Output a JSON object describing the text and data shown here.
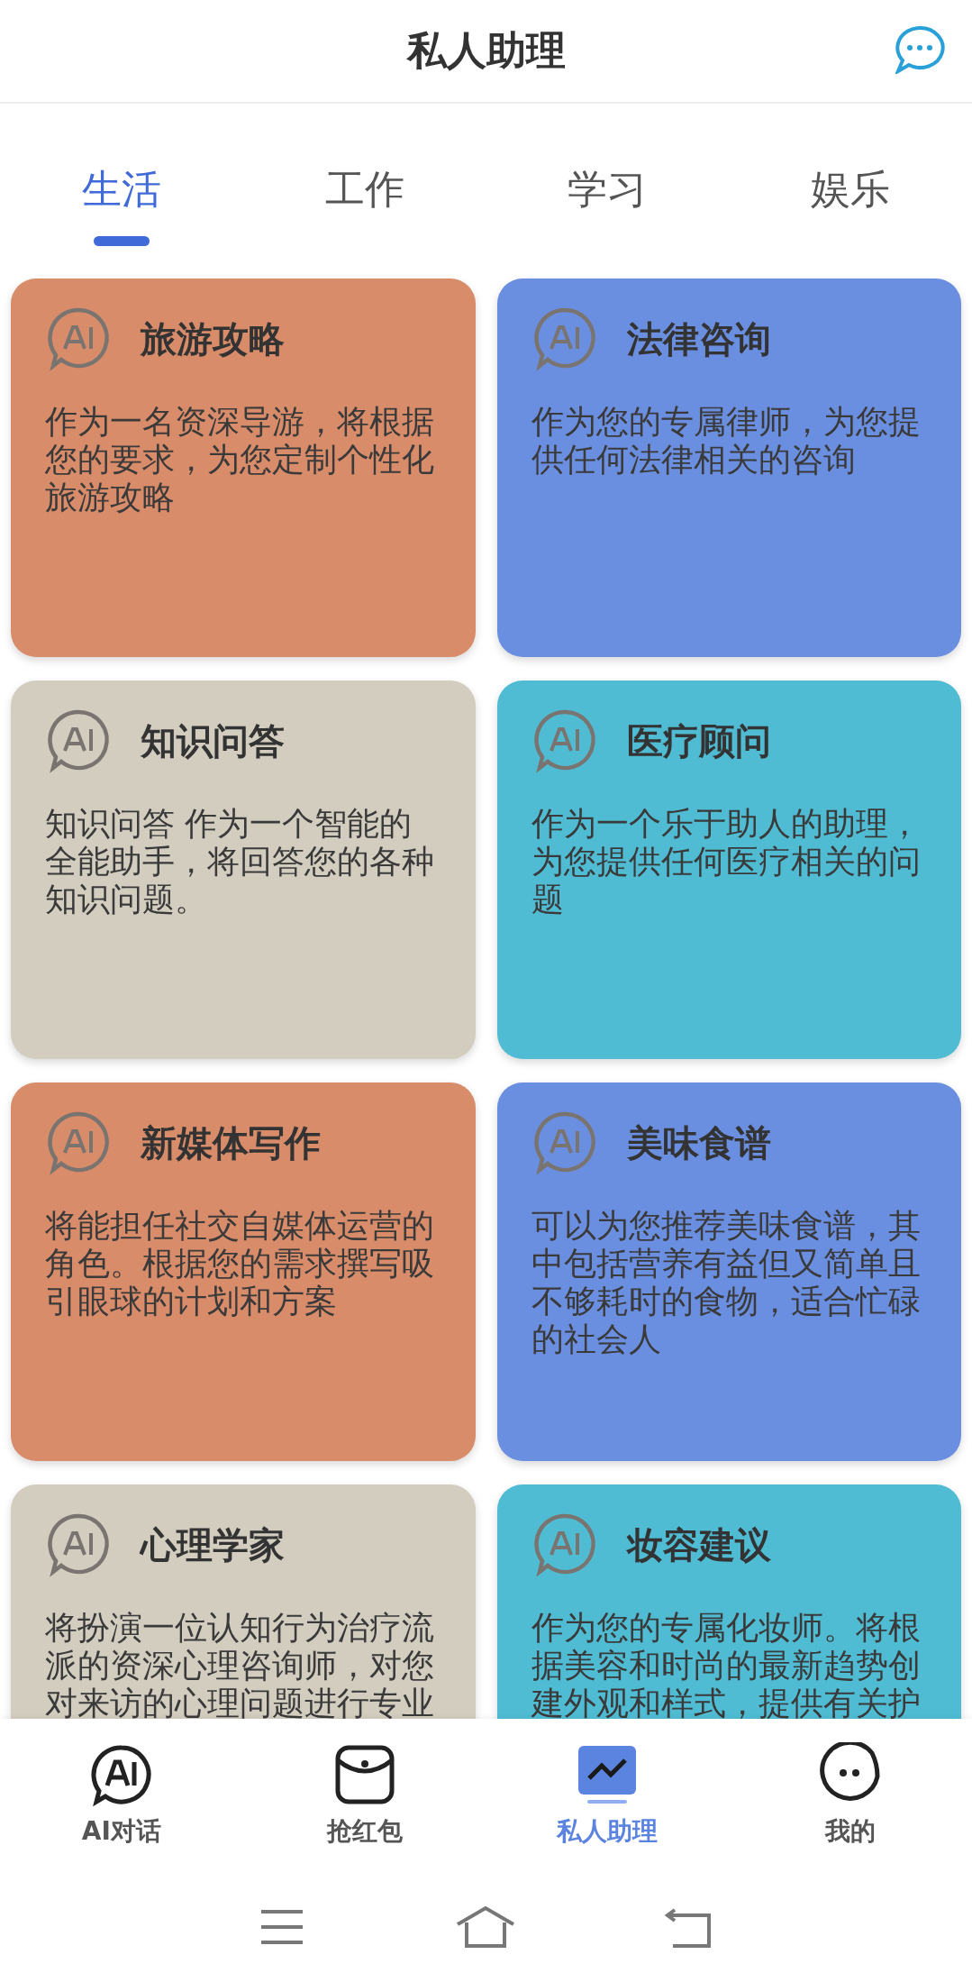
{
  "header": {
    "title": "私人助理"
  },
  "tabs": [
    {
      "label": "生活",
      "selected": true
    },
    {
      "label": "工作",
      "selected": false
    },
    {
      "label": "学习",
      "selected": false
    },
    {
      "label": "娱乐",
      "selected": false
    }
  ],
  "cards": [
    {
      "title": "旅游攻略",
      "description": "作为一名资深导游，将根据您的要求，为您定制个性化旅游攻略",
      "color": "#d98c6a"
    },
    {
      "title": "法律咨询",
      "description": "作为您的专属律师，为您提供任何法律相关的咨询",
      "color": "#6b8fe0"
    },
    {
      "title": "知识问答",
      "description": "知识问答 作为一个智能的全能助手，将回答您的各种知识问题。",
      "color": "#d3cdc0"
    },
    {
      "title": "医疗顾问",
      "description": "作为一个乐于助人的助理，为您提供任何医疗相关的问题",
      "color": "#4fbcd4"
    },
    {
      "title": "新媒体写作",
      "description": "将能担任社交自媒体运营的角色。根据您的需求撰写吸引眼球的计划和方案",
      "color": "#d98c6a"
    },
    {
      "title": "美味食谱",
      "description": "可以为您推荐美味食谱，其中包括营养有益但又简单且不够耗时的食物，适合忙碌的社会人",
      "color": "#6b8fe0"
    },
    {
      "title": "心理学家",
      "description": "将扮演一位认知行为治疗流派的资深心理咨询师，对您对来访的心理问题进行专业",
      "color": "#d3cdc0"
    },
    {
      "title": "妆容建议",
      "description": "作为您的专属化妆师。将根据美容和时尚的最新趋势创建外观和样式，提供有关护",
      "color": "#4fbcd4"
    }
  ],
  "bottom_nav": [
    {
      "label": "AI对话",
      "kind": "ai",
      "selected": false
    },
    {
      "label": "抢红包",
      "kind": "pouch",
      "selected": false
    },
    {
      "label": "私人助理",
      "kind": "chart",
      "selected": true
    },
    {
      "label": "我的",
      "kind": "smiley",
      "selected": false
    }
  ]
}
